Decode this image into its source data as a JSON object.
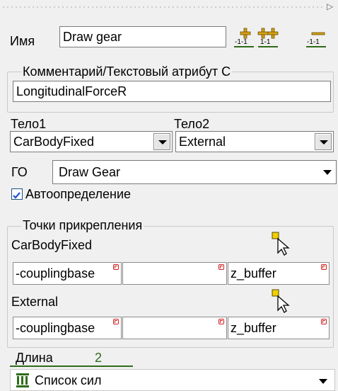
{
  "name_label": "Имя",
  "name_value": "Draw gear",
  "toolbar": {
    "icons": [
      "add-force-icon",
      "add-multiple-forces-icon",
      "remove-force-icon"
    ]
  },
  "comment_group": {
    "legend": "Комментарий/Текстовый атрибут С",
    "value": "LongitudinalForceR"
  },
  "body1": {
    "label": "Тело1",
    "value": "CarBodyFixed"
  },
  "body2": {
    "label": "Тело2",
    "value": "External"
  },
  "go": {
    "label": "ГО",
    "value": "Draw Gear"
  },
  "auto_detect": {
    "label": "Автоопределение",
    "checked": true
  },
  "attach_group": {
    "legend": "Точки прикрепления",
    "rows": [
      {
        "body": "CarBodyFixed",
        "x": "-couplingbase",
        "y": "",
        "z": "z_buffer"
      },
      {
        "body": "External",
        "x": "-couplingbase",
        "y": "",
        "z": "z_buffer"
      }
    ]
  },
  "length": {
    "label": "Длина",
    "value": "2"
  },
  "force_list": {
    "label": "Список сил",
    "icon": "force-list-icon"
  },
  "colors": {
    "window_bg": "#f0f0f0",
    "field_border": "#7a7a7a",
    "expression_mark": "#d01c1c",
    "checkbox_check": "#1f4fd6",
    "length_value": "#2f6b1a"
  }
}
